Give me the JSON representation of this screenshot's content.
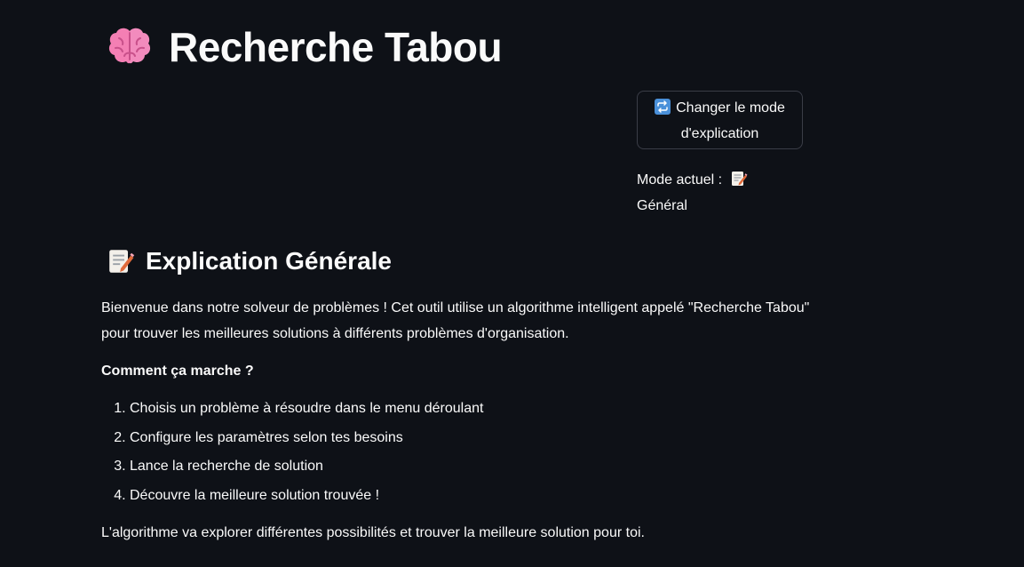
{
  "header": {
    "title": "Recherche Tabou",
    "icon": "brain-icon"
  },
  "mode_control": {
    "button_label": "Changer le mode d'explication",
    "button_icon": "repeat-icon",
    "status_label": "Mode actuel :",
    "status_icon": "memo-icon",
    "status_value": "Général"
  },
  "explanation": {
    "icon": "memo-icon",
    "title": "Explication Générale",
    "intro": "Bienvenue dans notre solveur de problèmes ! Cet outil utilise un algorithme intelligent appelé \"Recherche Tabou\" pour trouver les meilleures solutions à différents problèmes d'organisation.",
    "how_heading": "Comment ça marche ?",
    "steps": [
      "Choisis un problème à résoudre dans le menu déroulant",
      "Configure les paramètres selon tes besoins",
      "Lance la recherche de solution",
      "Découvre la meilleure solution trouvée !"
    ],
    "outro": "L'algorithme va explorer différentes possibilités et trouver la meilleure solution pour toi."
  },
  "colors": {
    "background": "#0e1117",
    "text": "#fafafa",
    "button_border": "#3a3d47"
  }
}
